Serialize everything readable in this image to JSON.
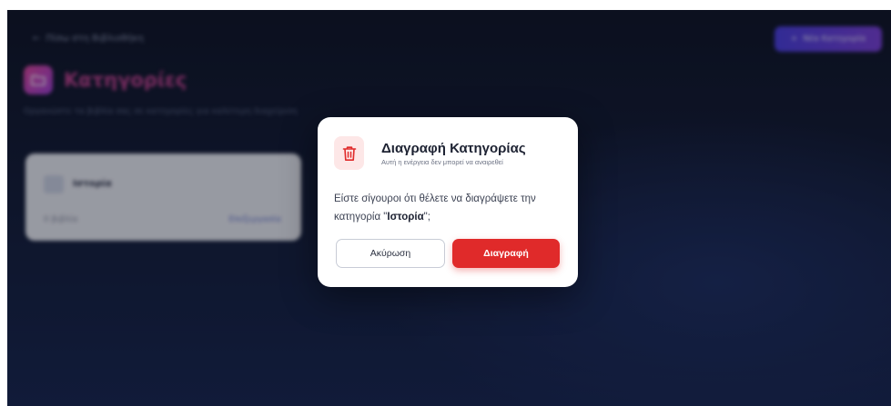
{
  "app": {
    "back_link": "Πίσω στη Βιβλιοθήκη",
    "new_button": "Νέα Κατηγορία",
    "page_title": "Κατηγορίες",
    "page_subtitle": "Οργανώστε τα βιβλία σας σε κατηγορίες για καλύτερη διαχείριση"
  },
  "category_card": {
    "name": "Ιστορία",
    "meta": "0 βιβλία",
    "edit": "Επεξεργασία"
  },
  "modal": {
    "title": "Διαγραφή Κατηγορίας",
    "subtitle": "Αυτή η ενέργεια δεν μπορεί να αναιρεθεί",
    "body_prefix": "Είστε σίγουροι ότι θέλετε να διαγράψετε την κατηγορία \"",
    "body_name": "Ιστορία",
    "body_suffix": "\";",
    "cancel_label": "Ακύρωση",
    "delete_label": "Διαγραφή",
    "icon": "trash-icon"
  },
  "colors": {
    "danger": "#e02a2a",
    "danger_soft": "#fde7e7",
    "accent": "#c2418e",
    "button_gradient_start": "#4a3ee0",
    "button_gradient_end": "#7b3fd8"
  }
}
